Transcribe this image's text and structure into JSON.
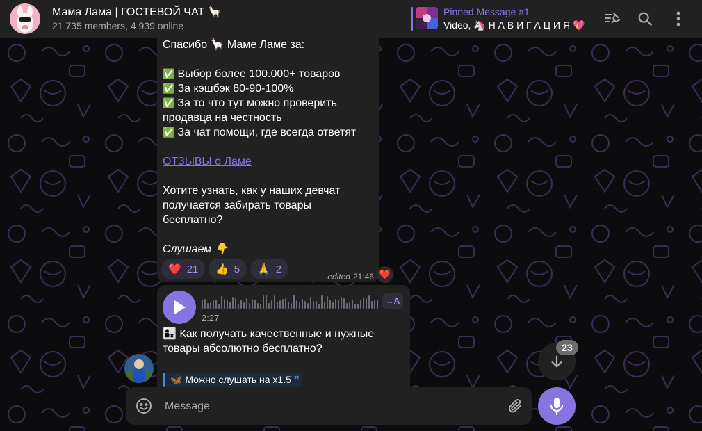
{
  "header": {
    "title": "Мама Лама | ГОСТЕВОЙ ЧАТ 🦙",
    "subtitle": "21 735 members, 4 939 online",
    "pinned": {
      "label": "Pinned Message #1",
      "text": "Video, 🦄 Н А В И Г А Ц И Я 💖"
    },
    "icons": [
      "pinned-list-icon",
      "search-icon",
      "more-vertical-icon"
    ]
  },
  "message1": {
    "lines": [
      "Спасибо 🦙 Маме Ламе за:",
      "",
      "Выбор более 100.000+ товаров",
      "За кэшбэк 80-90-100%",
      "За то что тут можно проверить",
      "продавца на честность",
      "За чат помощи, где всегда ответят",
      "",
      "ОТЗЫВЫ о Ламе",
      "",
      "Хотите узнать, как у наших девчат",
      "получается забирать товары",
      "бесплатно?",
      "",
      "Слушаем 👇"
    ],
    "check_glyph": "✅",
    "reactions": [
      {
        "emoji": "❤️",
        "count": "21"
      },
      {
        "emoji": "👍",
        "count": "5"
      },
      {
        "emoji": "🙏",
        "count": "2"
      }
    ],
    "edited": "edited",
    "time": "21:46",
    "my_reaction": "❤️"
  },
  "message2": {
    "duration": "2:27",
    "transcribe_label": "→A",
    "lines": [
      "👩‍👧 Как получать качественные и нужные",
      "товары абсолютно бесплатно?"
    ],
    "quote": "🦋 Можно слушать на х1.5",
    "quote_mark": "❞"
  },
  "scroll": {
    "unread_count": "23"
  },
  "composer": {
    "placeholder": "Message"
  },
  "colors": {
    "accent": "#8774e1",
    "header_bg": "#212121",
    "bubble_bg": "#212121",
    "background": "#0c0c0e"
  }
}
